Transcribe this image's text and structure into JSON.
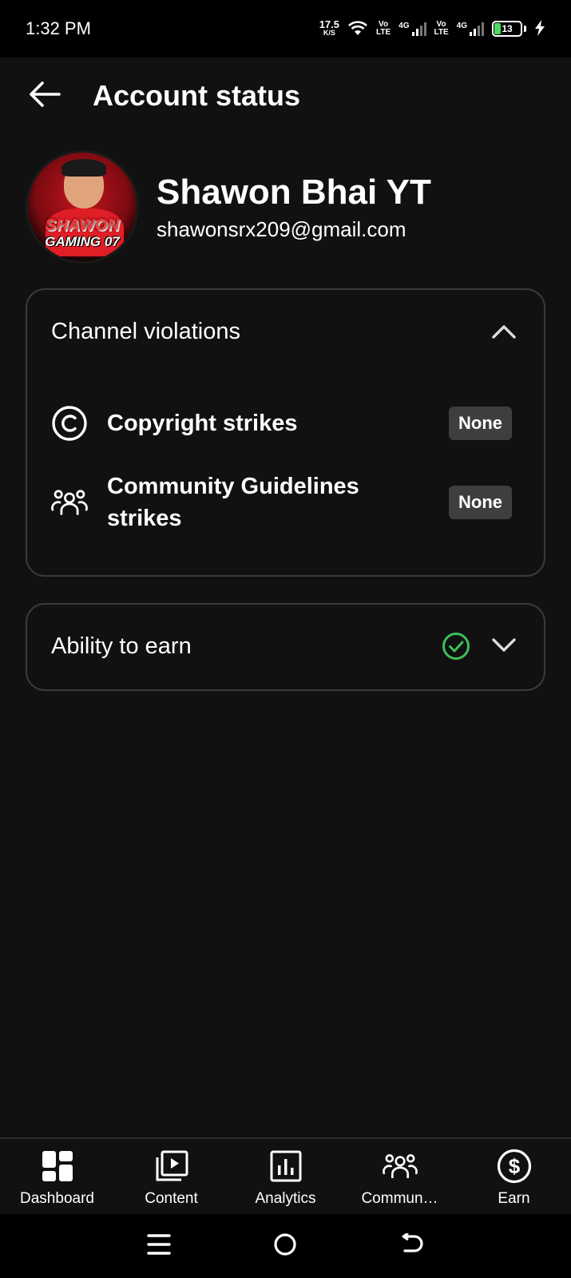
{
  "status_bar": {
    "time": "1:32 PM",
    "net_speed_value": "17.5",
    "net_speed_unit": "K/S",
    "volte1_top": "Vo",
    "volte1_bottom": "LTE",
    "net1": "4G",
    "volte2_top": "Vo",
    "volte2_bottom": "LTE",
    "net2": "4G",
    "battery_level": "13",
    "icons": [
      "wifi-icon",
      "signal-icon",
      "battery-icon",
      "charging-icon"
    ]
  },
  "header": {
    "title": "Account status",
    "back_icon": "arrow-left-icon"
  },
  "profile": {
    "name": "Shawon Bhai YT",
    "email": "shawonsrx209@gmail.com",
    "avatar_text_top": "SHAWON",
    "avatar_text_bottom": "GAMING 07"
  },
  "violations": {
    "title": "Channel violations",
    "expanded": true,
    "items": [
      {
        "icon": "copyright-icon",
        "label": "Copyright strikes",
        "status": "None"
      },
      {
        "icon": "community-icon",
        "label": "Community Guidelines strikes",
        "status": "None"
      }
    ]
  },
  "earn": {
    "title": "Ability to earn",
    "status_icon": "check-circle-icon",
    "expanded": false
  },
  "bottom_nav": {
    "items": [
      {
        "label": "Dashboard",
        "icon": "dashboard-icon"
      },
      {
        "label": "Content",
        "icon": "content-icon"
      },
      {
        "label": "Analytics",
        "icon": "analytics-icon"
      },
      {
        "label": "Commun…",
        "icon": "community-icon"
      },
      {
        "label": "Earn",
        "icon": "dollar-icon"
      }
    ]
  },
  "system_nav": [
    "menu-icon",
    "home-icon",
    "back-icon"
  ],
  "colors": {
    "background": "#111111",
    "card_border": "#3a3a3a",
    "badge_bg": "#3e3e3e",
    "check_green": "#3fbf5a",
    "battery_fill": "#4cd964"
  }
}
